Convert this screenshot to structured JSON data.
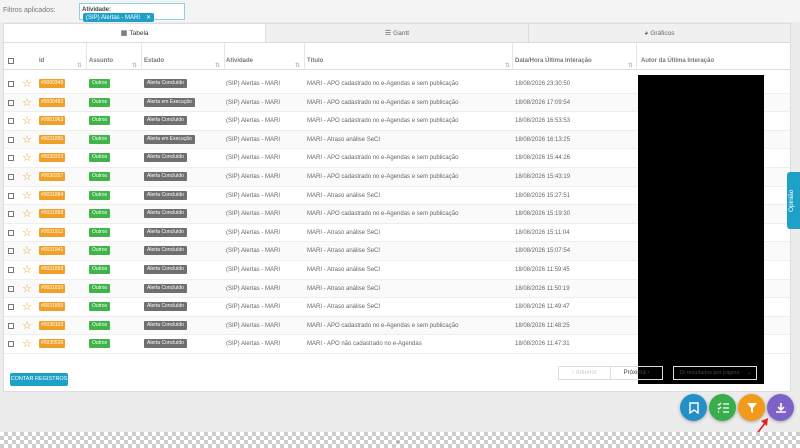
{
  "filters": {
    "label": "Filtros aplicados:",
    "key": "Atividade:",
    "chip": "(SIP) Alertas - MARI",
    "chip_close": "✕"
  },
  "tabs": [
    {
      "label": "Tabela",
      "icon": "table-icon",
      "active": true
    },
    {
      "label": "Gantt",
      "icon": "gantt-icon",
      "active": false
    },
    {
      "label": "Gráficos",
      "icon": "pie-chart-icon",
      "active": false
    }
  ],
  "columns": [
    "Id",
    "Assunto",
    "Estado",
    "Atividade",
    "Título",
    "Data/Hora Última Interação",
    "Autor da Última Interação"
  ],
  "rows": [
    {
      "id": "#0000349",
      "assunto": "Outros",
      "estado": "Alerta Concluído",
      "atividade": "(SIP) Alertas - MARI",
      "titulo": "MARI - APO cadastrado no e-Agendas e sem publicação",
      "data": "18/08/2026 23:30:50"
    },
    {
      "id": "#0000482",
      "assunto": "Outros",
      "estado": "Alerta em Execução",
      "atividade": "(SIP) Alertas - MARI",
      "titulo": "MARI - APO cadastrado no e-Agendas e sem publicação",
      "data": "18/08/2026 17:09:54"
    },
    {
      "id": "#0001963",
      "assunto": "Outros",
      "estado": "Alerta Concluído",
      "atividade": "(SIP) Alertas - MARI",
      "titulo": "MARI - APO cadastrado no e-Agendas e sem publicação",
      "data": "18/08/2026 16:53:53"
    },
    {
      "id": "#0031895",
      "assunto": "Outros",
      "estado": "Alerta em Execução",
      "atividade": "(SIP) Alertas - MARI",
      "titulo": "MARI - Atraso análise SeCI",
      "data": "18/08/2026 16:13:25"
    },
    {
      "id": "#0030203",
      "assunto": "Outros",
      "estado": "Alerta Concluído",
      "atividade": "(SIP) Alertas - MARI",
      "titulo": "MARI - APO cadastrado no e-Agendas e sem publicação",
      "data": "18/08/2026 15:44:26"
    },
    {
      "id": "#0030257",
      "assunto": "Outros",
      "estado": "Alerta Concluído",
      "atividade": "(SIP) Alertas - MARI",
      "titulo": "MARI - APO cadastrado no e-Agendas e sem publicação",
      "data": "18/08/2026 15:43:19"
    },
    {
      "id": "#0031884",
      "assunto": "Outros",
      "estado": "Alerta Concluído",
      "atividade": "(SIP) Alertas - MARI",
      "titulo": "MARI - Atraso análise SeCI",
      "data": "18/08/2026 15:27:51"
    },
    {
      "id": "#0031868",
      "assunto": "Outros",
      "estado": "Alerta Concluído",
      "atividade": "(SIP) Alertas - MARI",
      "titulo": "MARI - APO cadastrado no e-Agendas e sem publicação",
      "data": "18/08/2026 15:19:30"
    },
    {
      "id": "#0031912",
      "assunto": "Outros",
      "estado": "Alerta Concluído",
      "atividade": "(SIP) Alertas - MARI",
      "titulo": "MARI - Atraso análise SeCI",
      "data": "18/08/2026 15:11:04"
    },
    {
      "id": "#0031941",
      "assunto": "Outros",
      "estado": "Alerta Concluído",
      "atividade": "(SIP) Alertas - MARI",
      "titulo": "MARI - Atraso análise SeCI",
      "data": "18/08/2026 15:07:54"
    },
    {
      "id": "#0031858",
      "assunto": "Outros",
      "estado": "Alerta Concluído",
      "atividade": "(SIP) Alertas - MARI",
      "titulo": "MARI - Atraso análise SeCI",
      "data": "18/08/2026 11:59:45"
    },
    {
      "id": "#0031810",
      "assunto": "Outros",
      "estado": "Alerta Concluído",
      "atividade": "(SIP) Alertas - MARI",
      "titulo": "MARI - Atraso análise SeCI",
      "data": "18/08/2026 11:50:19"
    },
    {
      "id": "#0031855",
      "assunto": "Outros",
      "estado": "Alerta Concluído",
      "atividade": "(SIP) Alertas - MARI",
      "titulo": "MARI - Atraso análise SeCI",
      "data": "18/08/2026 11:49:47"
    },
    {
      "id": "#0030102",
      "assunto": "Outros",
      "estado": "Alerta Concluído",
      "atividade": "(SIP) Alertas - MARI",
      "titulo": "MARI - APO cadastrado no e-Agendas e sem publicação",
      "data": "18/08/2026 11:48:25"
    },
    {
      "id": "#0030536",
      "assunto": "Outros",
      "estado": "Alerta Concluído",
      "atividade": "(SIP) Alertas - MARI",
      "titulo": "MARI - APO não cadastrado no e-Agendas",
      "data": "18/08/2026 11:47:31"
    }
  ],
  "count_button": "CONTAR REGISTROS",
  "pager": {
    "prev": "‹ Anterior",
    "next": "Próxima ›"
  },
  "per_page": "15 resultados por página",
  "side_tab": "Opinião",
  "fabs": [
    {
      "icon": "bookmark-icon",
      "color": "#2490c7"
    },
    {
      "icon": "list-check-icon",
      "color": "#39ad4c"
    },
    {
      "icon": "filter-icon",
      "color": "#f29a1c"
    },
    {
      "icon": "download-icon",
      "color": "#7f62c7"
    }
  ],
  "colors": {
    "accent": "#1fa1c7",
    "id_badge": "#f0a028",
    "assunto_badge": "#41b449",
    "estado_badge": "#6f6f6f"
  }
}
